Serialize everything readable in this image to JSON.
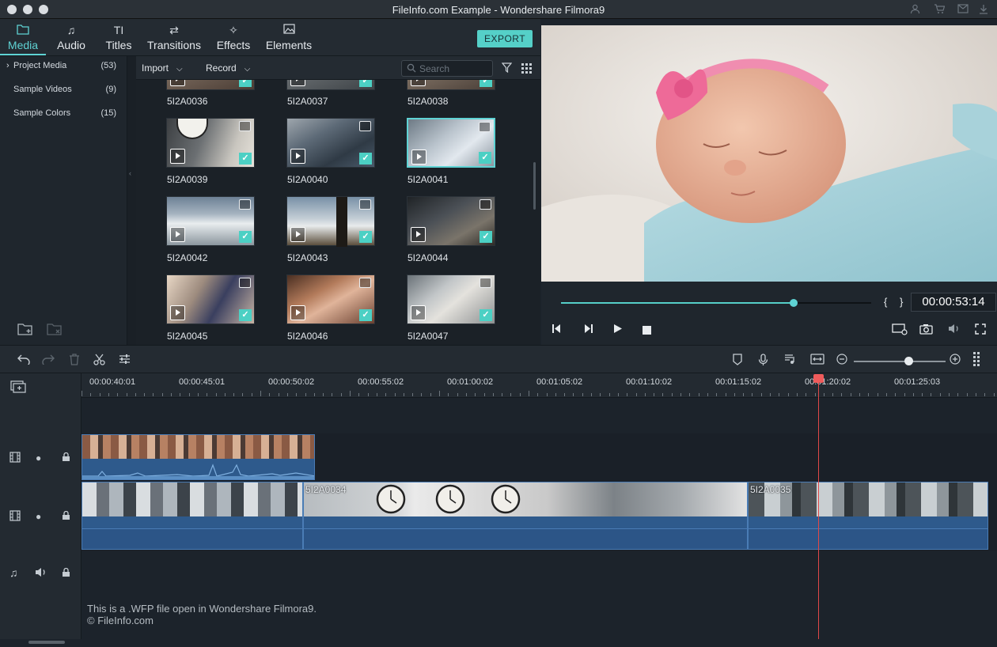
{
  "window": {
    "title": "FileInfo.com Example - Wondershare Filmora9"
  },
  "tabs": [
    {
      "label": "Media",
      "icon": "folder-icon"
    },
    {
      "label": "Audio",
      "icon": "music-note-icon"
    },
    {
      "label": "Titles",
      "icon": "text-title-icon"
    },
    {
      "label": "Transitions",
      "icon": "transitions-icon"
    },
    {
      "label": "Effects",
      "icon": "effects-sparkle-icon"
    },
    {
      "label": "Elements",
      "icon": "image-elements-icon"
    }
  ],
  "export_label": "EXPORT",
  "sidebar": {
    "items": [
      {
        "label": "Project Media",
        "count": "(53)"
      },
      {
        "label": "Sample Videos",
        "count": "(9)"
      },
      {
        "label": "Sample Colors",
        "count": "(15)"
      }
    ]
  },
  "media_toolbar": {
    "import_label": "Import",
    "record_label": "Record",
    "search_placeholder": "Search"
  },
  "media_clips": [
    {
      "name": "5I2A0036"
    },
    {
      "name": "5I2A0037"
    },
    {
      "name": "5I2A0038"
    },
    {
      "name": "5I2A0039"
    },
    {
      "name": "5I2A0040"
    },
    {
      "name": "5I2A0041"
    },
    {
      "name": "5I2A0042"
    },
    {
      "name": "5I2A0043"
    },
    {
      "name": "5I2A0044"
    },
    {
      "name": "5I2A0045"
    },
    {
      "name": "5I2A0046"
    },
    {
      "name": "5I2A0047"
    }
  ],
  "selected_clip": "5I2A0041",
  "player": {
    "timecode": "00:00:53:14",
    "progress": 0.75,
    "mark_in": "{",
    "mark_out": "}"
  },
  "timeline": {
    "ruler_labels": [
      "00:00:40:01",
      "00:00:45:01",
      "00:00:50:02",
      "00:00:55:02",
      "00:01:00:02",
      "00:01:05:02",
      "00:01:10:02",
      "00:01:15:02",
      "00:01:20:02",
      "00:01:25:03"
    ],
    "clips": [
      {
        "name": "5I2A0034"
      },
      {
        "name": "5I2A0035"
      }
    ],
    "zoom_level": 0.6
  },
  "footnote": {
    "line1": "This is a .WFP file open in Wondershare Filmora9.",
    "line2": "© FileInfo.com"
  },
  "colors": {
    "accent": "#5fd3d4",
    "playhead": "#e04848",
    "clip_blue": "#2e5a8c"
  }
}
